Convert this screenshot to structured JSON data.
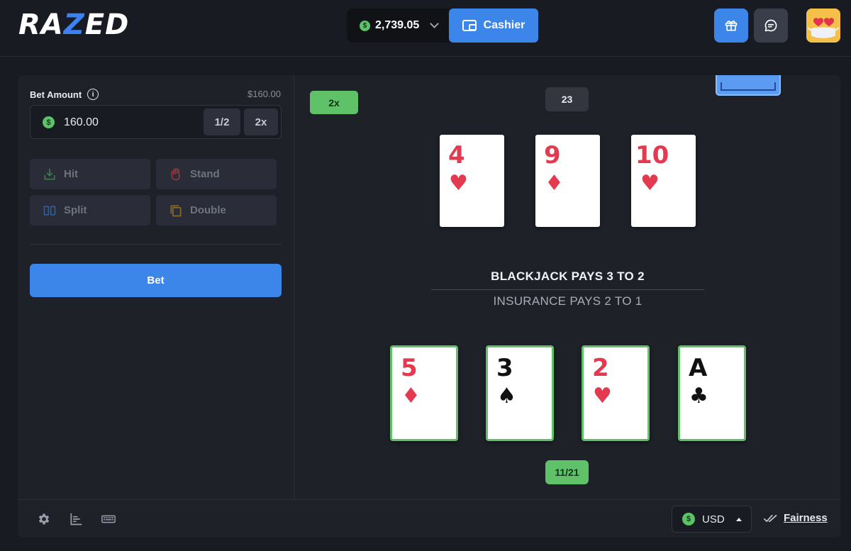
{
  "header": {
    "logo": {
      "part1": "RA",
      "part2": "Z",
      "part3": "ED"
    },
    "balance": "2,739.05",
    "cashier_label": "Cashier",
    "coin_symbol": "$",
    "icons": {
      "gift": "gift-icon",
      "chat": "chat-icon",
      "avatar": "emoji-avatar"
    }
  },
  "bet_panel": {
    "label": "Bet Amount",
    "info_symbol": "i",
    "usd_value": "$160.00",
    "amount": "160.00",
    "half_label": "1/2",
    "double_label": "2x",
    "actions": {
      "hit": "Hit",
      "stand": "Stand",
      "split": "Split",
      "double": "Double"
    },
    "bet_button": "Bet"
  },
  "table": {
    "multiplier_badge": "2x",
    "dealer_score": "23",
    "player_score": "11/21",
    "dealer_cards": [
      {
        "rank": "4",
        "suit": "♥",
        "color": "red"
      },
      {
        "rank": "9",
        "suit": "♦",
        "color": "red"
      },
      {
        "rank": "10",
        "suit": "♥",
        "color": "red"
      }
    ],
    "player_cards": [
      {
        "rank": "5",
        "suit": "♦",
        "color": "red"
      },
      {
        "rank": "3",
        "suit": "♠",
        "color": "black"
      },
      {
        "rank": "2",
        "suit": "♥",
        "color": "red"
      },
      {
        "rank": "A",
        "suit": "♣",
        "color": "black"
      }
    ],
    "blackjack_pays": "BLACKJACK PAYS 3 TO 2",
    "insurance_pays": "INSURANCE PAYS 2 TO 1"
  },
  "footer": {
    "currency": "USD",
    "fairness": "Fairness"
  },
  "colors": {
    "accent": "#3c86ea",
    "win": "#5fc168",
    "red_suit": "#e33a4f",
    "background": "#191b22",
    "panel": "#1f2129"
  }
}
